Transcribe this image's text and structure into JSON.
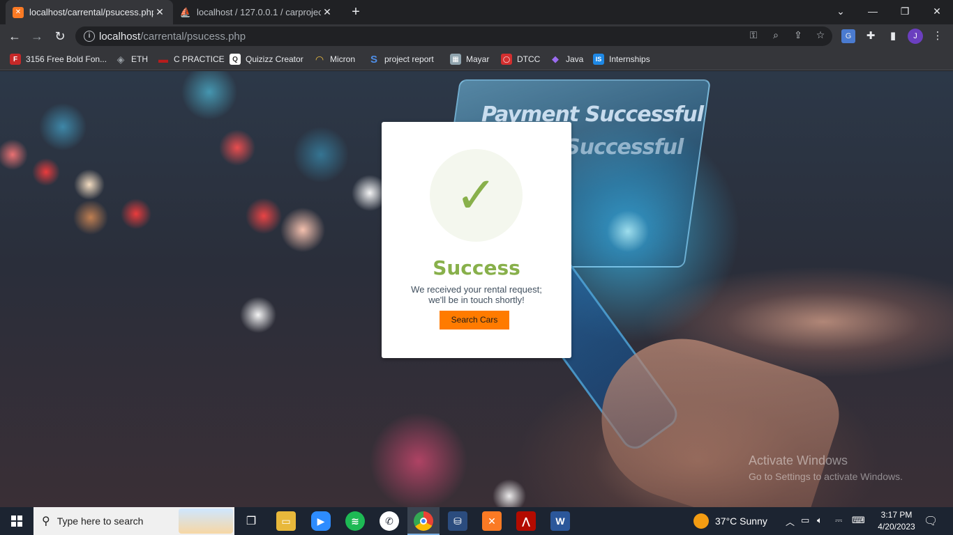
{
  "browser": {
    "tabs": [
      {
        "title": "localhost/carrental/psucess.php",
        "close": "✕",
        "favicon_color": "#fb7a24"
      },
      {
        "title": "localhost / 127.0.0.1 / carproject",
        "close": "✕",
        "favicon_color": "#f0a30a"
      }
    ],
    "new_tab": "+",
    "window_controls": {
      "dropdown": "⌄",
      "minimize": "—",
      "restore": "❐",
      "close": "✕"
    },
    "nav": {
      "back": "←",
      "forward": "→",
      "reload": "↻"
    },
    "address": {
      "host": "localhost",
      "path": "/carrental/psucess.php"
    },
    "profile_initial": "J",
    "menu": "⋮"
  },
  "bookmarks": [
    {
      "label": "3156 Free Bold Fon...",
      "icon": "F",
      "color": "#c62828"
    },
    {
      "label": "ETH",
      "icon": "◈",
      "color": "#5f6368"
    },
    {
      "label": "C PRACTICE",
      "icon": "▬",
      "color": "#b71c1c"
    },
    {
      "label": "Quizizz Creator",
      "icon": "Q",
      "color": "#2d2d2d"
    },
    {
      "label": "Micron",
      "icon": "◠",
      "color": "#3b6db3"
    },
    {
      "label": "project report",
      "icon": "S",
      "color": "#1a73e8"
    },
    {
      "label": "Mayar",
      "icon": "▦",
      "color": "#607d8b"
    },
    {
      "label": "DTCC",
      "icon": "◯",
      "color": "#d32f2f"
    },
    {
      "label": "Java",
      "icon": "◆",
      "color": "#7b3fe4"
    },
    {
      "label": "Internships",
      "icon": "IS",
      "color": "#1e88e5"
    }
  ],
  "background": {
    "ghost_text_1": "Payment Successful",
    "ghost_text_2": "Successful"
  },
  "modal": {
    "check": "✓",
    "title": "Success",
    "message_line1": "We received your rental request;",
    "message_line2": "we'll be in touch shortly!",
    "button": "Search Cars"
  },
  "watermark": {
    "line1": "Activate Windows",
    "line2": "Go to Settings to activate Windows."
  },
  "taskbar": {
    "search_placeholder": "Type here to search",
    "weather": "37°C  Sunny",
    "time": "3:17 PM",
    "date": "4/20/2023"
  }
}
